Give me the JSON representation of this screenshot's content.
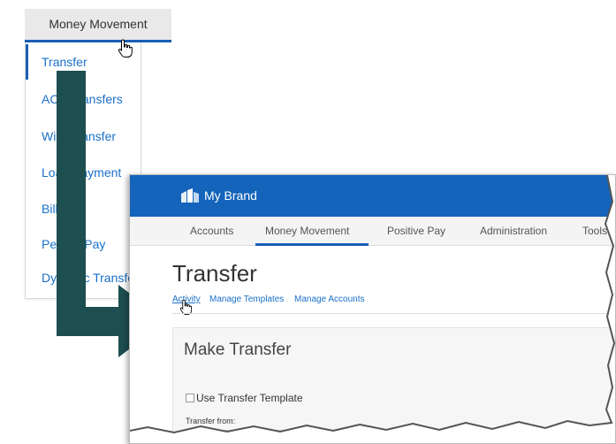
{
  "dropdown": {
    "header": "Money Movement",
    "items": [
      {
        "label": "Transfer"
      },
      {
        "label": "ACH Transfers"
      },
      {
        "label": "Wire Transfer"
      },
      {
        "label": "Loan Payment"
      },
      {
        "label": "Bill Pay"
      },
      {
        "label": "Person Pay"
      },
      {
        "label": "Dynamic Transfer"
      }
    ]
  },
  "app": {
    "brand": "My Brand",
    "nav": [
      {
        "label": "Accounts"
      },
      {
        "label": "Money Movement"
      },
      {
        "label": "Positive Pay"
      },
      {
        "label": "Administration"
      },
      {
        "label": "Tools"
      }
    ],
    "page_title": "Transfer",
    "sublinks": [
      {
        "label": "Activity"
      },
      {
        "label": "Manage Templates"
      },
      {
        "label": "Manage Accounts"
      }
    ],
    "panel": {
      "title": "Make Transfer",
      "checkbox_label": "Use Transfer Template",
      "field_label": "Transfer from:"
    }
  },
  "colors": {
    "brand": "#1464bb",
    "link": "#1a6fc8",
    "arrow": "#1d4e50",
    "active_underline": "#1a5fb4"
  },
  "icons": [
    "hand-cursor-icon",
    "brand-logo-icon",
    "arrow-icon"
  ]
}
